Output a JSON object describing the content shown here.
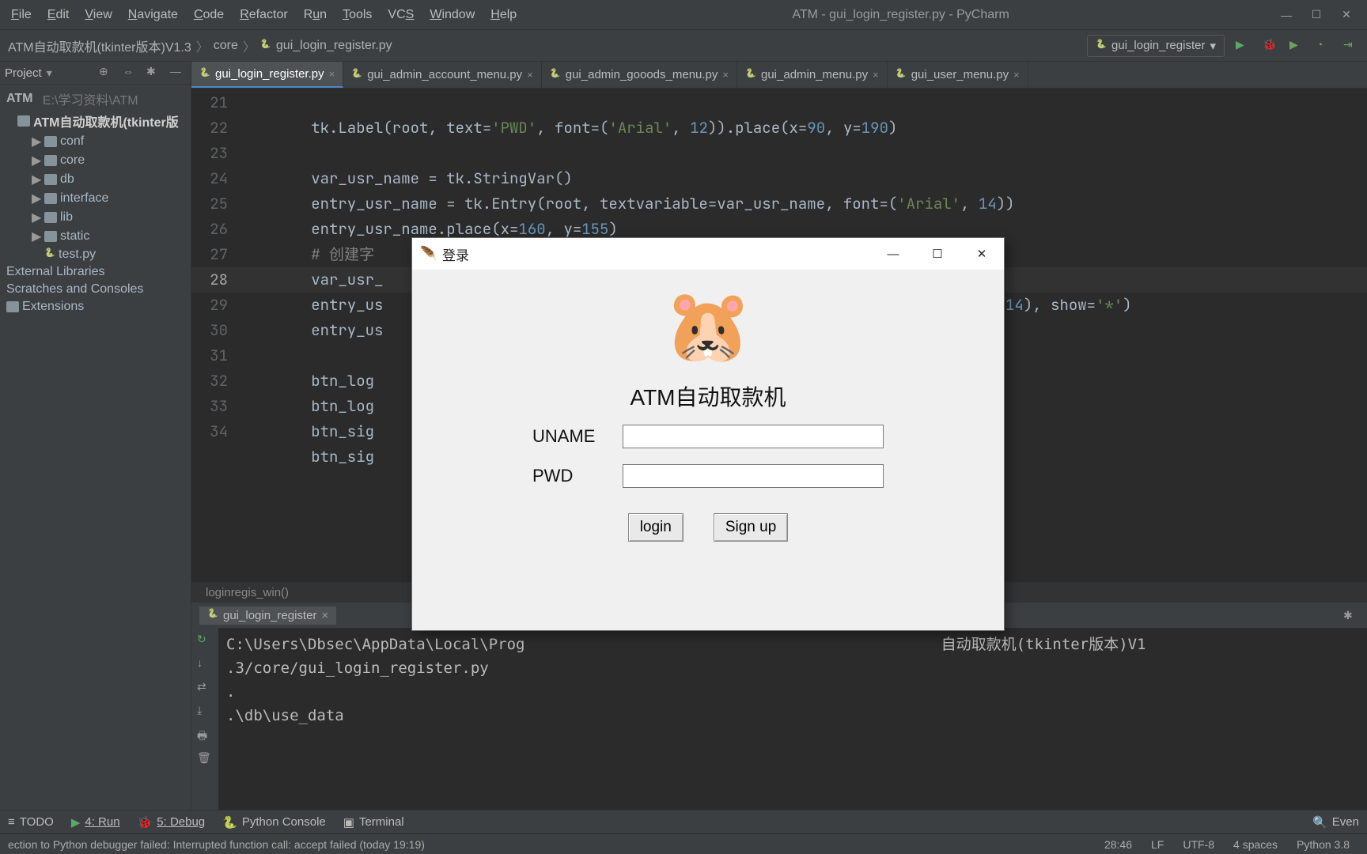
{
  "titlebar": {
    "menus": [
      "File",
      "Edit",
      "View",
      "Navigate",
      "Code",
      "Refactor",
      "Run",
      "Tools",
      "VCS",
      "Window",
      "Help"
    ],
    "title": "ATM - gui_login_register.py - PyCharm"
  },
  "breadcrumb": {
    "root": "ATM自动取款机(tkinter版本)V1.3",
    "folder": "core",
    "file": "gui_login_register.py"
  },
  "run_config": {
    "label": "gui_login_register"
  },
  "sidebar": {
    "label": "Project",
    "project_name": "ATM",
    "project_path": "E:\\学习资料\\ATM",
    "subproject": "ATM自动取款机(tkinter版",
    "folders": [
      "conf",
      "core",
      "db",
      "interface",
      "lib",
      "static"
    ],
    "file": "test.py",
    "extra": [
      "External Libraries",
      "Scratches and Consoles",
      "Extensions"
    ]
  },
  "tabs": [
    "gui_login_register.py",
    "gui_admin_account_menu.py",
    "gui_admin_gooods_menu.py",
    "gui_admin_menu.py",
    "gui_user_menu.py"
  ],
  "code": {
    "line_start": 21,
    "lines": [
      "        tk.Label(root, text='PWD', font=('Arial', 12)).place(x=90, y=190)",
      "",
      "        var_usr_name = tk.StringVar()",
      "        entry_usr_name = tk.Entry(root, textvariable=var_usr_name, font=('Arial', 14))",
      "        entry_usr_name.place(x=160, y=155)",
      "        # 创建字",
      "        var_usr_",
      "        entry_us                                                          =('Arial', 14), show='*')",
      "        entry_us",
      "",
      "        btn_log",
      "        btn_log",
      "        btn_sig                                                           r_wind)",
      "        btn_sig"
    ],
    "breadcrumb_fn": "loginregis_win()"
  },
  "run_panel": {
    "tab_label": "gui_login_register",
    "output_lines": [
      "C:\\Users\\Dbsec\\AppData\\Local\\Prog                                              自动取款机(tkinter版本)V1",
      ".3/core/gui_login_register.py",
      ".",
      ".\\db\\use_data"
    ]
  },
  "bottom_tools": {
    "todo": "TODO",
    "run": "4: Run",
    "debug": "5: Debug",
    "console": "Python Console",
    "terminal": "Terminal",
    "event": "Even"
  },
  "status": {
    "msg": "ection to Python debugger failed: Interrupted function call: accept failed (today 19:19)",
    "pos": "28:46",
    "le": "LF",
    "enc": "UTF-8",
    "indent": "4 spaces",
    "python": "Python 3.8"
  },
  "tk_dialog": {
    "title": "登录",
    "heading": "ATM自动取款机",
    "uname_label": "UNAME",
    "pwd_label": "PWD",
    "login_btn": "login",
    "signup_btn": "Sign up"
  }
}
